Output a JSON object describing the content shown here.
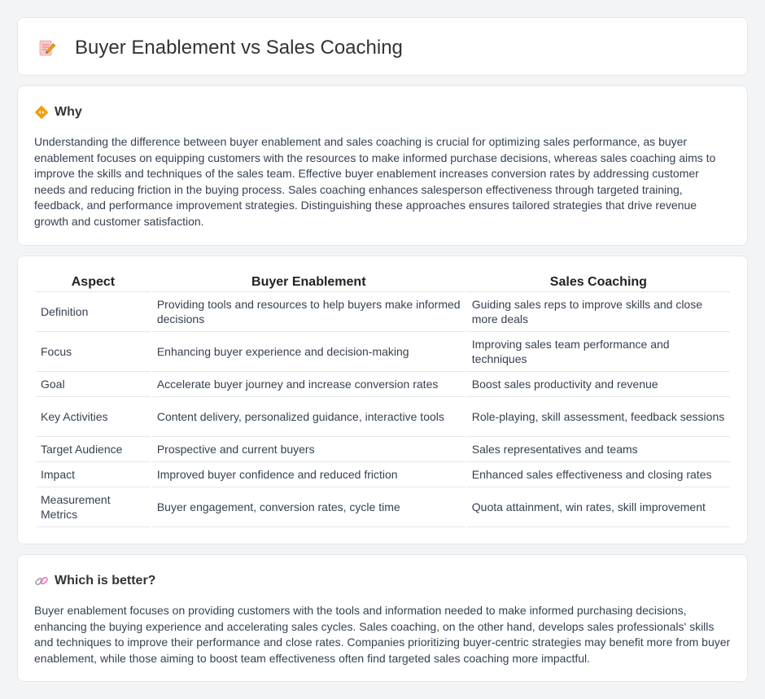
{
  "header": {
    "title": "Buyer Enablement vs Sales Coaching",
    "icon": "document-pencil-icon"
  },
  "why": {
    "heading": "Why",
    "icon": "diamond-arrows-icon",
    "text": "Understanding the difference between buyer enablement and sales coaching is crucial for optimizing sales performance, as buyer enablement focuses on equipping customers with the resources to make informed purchase decisions, whereas sales coaching aims to improve the skills and techniques of the sales team. Effective buyer enablement increases conversion rates by addressing customer needs and reducing friction in the buying process. Sales coaching enhances salesperson effectiveness through targeted training, feedback, and performance improvement strategies. Distinguishing these approaches ensures tailored strategies that drive revenue growth and customer satisfaction."
  },
  "table": {
    "headers": [
      "Aspect",
      "Buyer Enablement",
      "Sales Coaching"
    ],
    "rows": [
      [
        "Definition",
        "Providing tools and resources to help buyers make informed decisions",
        "Guiding sales reps to improve skills and close more deals"
      ],
      [
        "Focus",
        "Enhancing buyer experience and decision-making",
        "Improving sales team performance and techniques"
      ],
      [
        "Goal",
        "Accelerate buyer journey and increase conversion rates",
        "Boost sales productivity and revenue"
      ],
      [
        "Key Activities",
        "Content delivery, personalized guidance, interactive tools",
        "Role-playing, skill assessment, feedback sessions"
      ],
      [
        "Target Audience",
        "Prospective and current buyers",
        "Sales representatives and teams"
      ],
      [
        "Impact",
        "Improved buyer confidence and reduced friction",
        "Enhanced sales effectiveness and closing rates"
      ],
      [
        "Measurement Metrics",
        "Buyer engagement, conversion rates, cycle time",
        "Quota attainment, win rates, skill improvement"
      ]
    ]
  },
  "better": {
    "heading": "Which is better?",
    "icon": "link-icon",
    "text": "Buyer enablement focuses on providing customers with the tools and information needed to make informed purchasing decisions, enhancing the buying experience and accelerating sales cycles. Sales coaching, on the other hand, develops sales professionals' skills and techniques to improve their performance and close rates. Companies prioritizing buyer-centric strategies may benefit more from buyer enablement, while those aiming to boost team effectiveness often find targeted sales coaching more impactful."
  },
  "colors": {
    "background": "#f3f4f6",
    "card": "#ffffff",
    "border": "#e5e7eb",
    "icon_orange": "#f59e0b",
    "icon_pink": "#f472b6"
  }
}
